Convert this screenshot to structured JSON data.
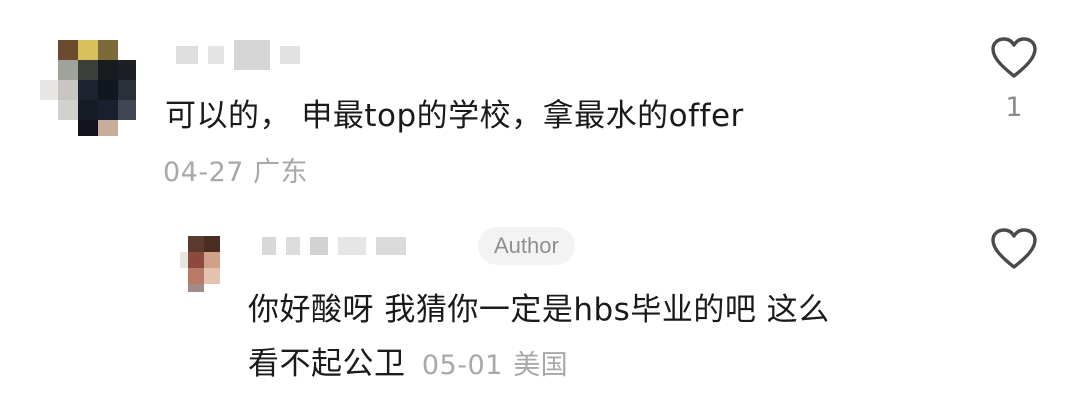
{
  "comments": [
    {
      "text": "可以的， 申最top的学校，拿最水的offer",
      "date": "04-27",
      "location": "广东",
      "likes": "1"
    }
  ],
  "reply": {
    "badge": "Author",
    "text_line1": "你好酸呀 我猜你一定是hbs毕业的吧 这么",
    "text_line2": "看不起公卫",
    "date": "05-01",
    "location": "美国"
  },
  "icons": {
    "like": "heart-outline-icon"
  },
  "colors": {
    "text": "#1a1a1a",
    "meta": "#a8a8a8",
    "badge_bg": "#f3f3f3"
  }
}
